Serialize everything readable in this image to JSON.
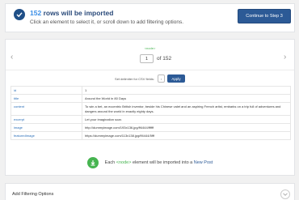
{
  "header": {
    "count": "152",
    "headline_suffix": "rows will be imported",
    "subline": "Click an element to select it, or scroll down to add filtering options.",
    "continue_label": "Continue to Step 3"
  },
  "preview": {
    "node_tag": "<node>",
    "prev_arrow": "‹",
    "next_arrow": "›",
    "current_page": "1",
    "total_label": "of 152"
  },
  "delimiter": {
    "label": "Set delimiter for CSV fields:",
    "value": ",",
    "apply_label": "Apply"
  },
  "record": [
    {
      "key": "id",
      "value": "1"
    },
    {
      "key": "title",
      "value": "Around the World in 80 Days"
    },
    {
      "key": "content",
      "value": "To win a bet, an eccentric British inventor, beside his Chinese valet and an aspiring French artist, embarks on a trip full of adventures and dangers around the world in exactly eighty days."
    },
    {
      "key": "excerpt",
      "value": "Let your imagination soar."
    },
    {
      "key": "image",
      "value": "http://dummyimage.com/193x136.jpg/ff4444/ffffff"
    },
    {
      "key": "featuredImage",
      "value": "https://dummyimage.com/113x138.jpg/ff4444/5fff"
    }
  ],
  "import_info": {
    "prefix": "Each",
    "node": "<node>",
    "middle": "element will be imported into a",
    "post_type": "New Post"
  },
  "filtering": {
    "title": "Add Filtering Options"
  },
  "colors": {
    "primary": "#2c5a96",
    "accent_green": "#46b450",
    "link_blue": "#2a6eb8"
  },
  "icons": {
    "status": "check-icon",
    "import": "import-icon",
    "toggle": "chevron-down-icon"
  }
}
